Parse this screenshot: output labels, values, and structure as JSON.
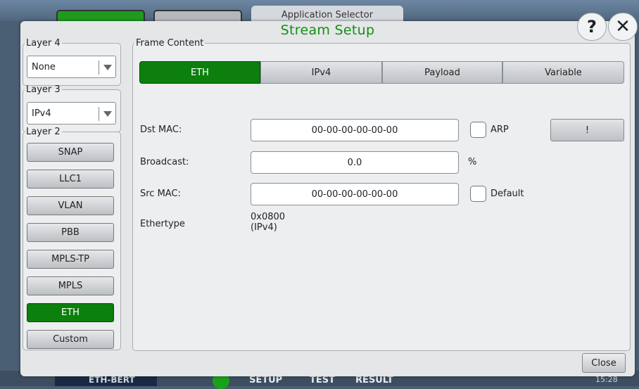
{
  "background": {
    "app_selector": "Application Selector",
    "bottom_bar": {
      "test_name": "ETH-BERT",
      "setup_label": "SETUP",
      "test_label": "TEST",
      "result_label": "RESULT",
      "time": "15:28"
    }
  },
  "dialog": {
    "title": "Stream Setup",
    "help_label": "?",
    "close_icon_label": "✕",
    "close_button": "Close"
  },
  "layer4": {
    "legend": "Layer 4",
    "value": "None"
  },
  "layer3": {
    "legend": "Layer 3",
    "value": "IPv4"
  },
  "layer2": {
    "legend": "Layer 2",
    "buttons": [
      "SNAP",
      "LLC1",
      "VLAN",
      "PBB",
      "MPLS-TP",
      "MPLS",
      "ETH",
      "Custom"
    ],
    "active": "ETH"
  },
  "frame_content": {
    "legend": "Frame Content",
    "tabs": [
      "ETH",
      "IPv4",
      "Payload",
      "Variable"
    ],
    "active_tab": "ETH",
    "dst_mac": {
      "label": "Dst MAC:",
      "value": "00-00-00-00-00-00",
      "arp_label": "ARP",
      "arp_checked": false
    },
    "action_button": "!",
    "broadcast": {
      "label": "Broadcast:",
      "value": "0.0",
      "unit": "%"
    },
    "src_mac": {
      "label": "Src MAC:",
      "value": "00-00-00-00-00-00",
      "default_label": "Default",
      "default_checked": false
    },
    "ethertype": {
      "label": "Ethertype",
      "value_line1": "0x0800",
      "value_line2": "(IPv4)"
    }
  },
  "colors": {
    "accent_green": "#0d7f0d",
    "title_green": "#129012"
  }
}
